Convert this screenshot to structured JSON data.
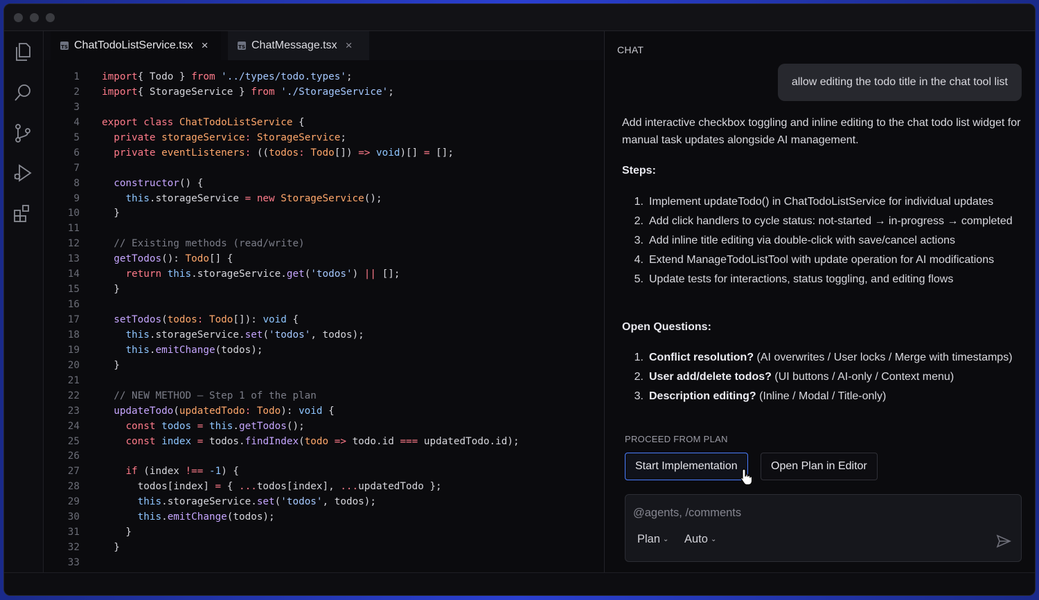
{
  "editor": {
    "tabs": [
      {
        "label": "ChatTodoListService.tsx",
        "icon": "ts-file-icon",
        "active": true
      },
      {
        "label": "ChatMessage.tsx",
        "icon": "ts-file-icon",
        "active": false
      }
    ],
    "ts_badge": "TS",
    "close_glyph": "×",
    "line_numbers": [
      "1",
      "2",
      "3",
      "4",
      "5",
      "6",
      "7",
      "8",
      "9",
      "10",
      "11",
      "12",
      "13",
      "14",
      "15",
      "16",
      "17",
      "18",
      "19",
      "20",
      "21",
      "22",
      "23",
      "24",
      "25",
      "26",
      "27",
      "28",
      "29",
      "30",
      "31",
      "32",
      "33"
    ],
    "code_lines": [
      [
        [
          "kw",
          "import"
        ],
        [
          "",
          "{ Todo } "
        ],
        [
          "kw",
          "from"
        ],
        [
          "",
          " "
        ],
        [
          "str",
          "'../types/todo.types'"
        ],
        [
          "",
          ";"
        ]
      ],
      [
        [
          "kw",
          "import"
        ],
        [
          "",
          "{ StorageService } "
        ],
        [
          "kw",
          "from"
        ],
        [
          "",
          " "
        ],
        [
          "str",
          "'./StorageService'"
        ],
        [
          "",
          ";"
        ]
      ],
      [],
      [
        [
          "kw",
          "export class"
        ],
        [
          "",
          " "
        ],
        [
          "ty",
          "ChatTodoListService"
        ],
        [
          "",
          " {"
        ]
      ],
      [
        [
          "",
          "  "
        ],
        [
          "kw",
          "private"
        ],
        [
          "",
          " "
        ],
        [
          "pa",
          "storageService"
        ],
        [
          "kw",
          ":"
        ],
        [
          "",
          " "
        ],
        [
          "ty",
          "StorageService"
        ],
        [
          "",
          ";"
        ]
      ],
      [
        [
          "",
          "  "
        ],
        [
          "kw",
          "private"
        ],
        [
          "",
          " "
        ],
        [
          "pa",
          "eventListeners"
        ],
        [
          "kw",
          ":"
        ],
        [
          "",
          " (("
        ],
        [
          "pa",
          "todos"
        ],
        [
          "kw",
          ":"
        ],
        [
          "",
          " "
        ],
        [
          "ty",
          "Todo"
        ],
        [
          "",
          "[]) "
        ],
        [
          "kw",
          "=>"
        ],
        [
          "",
          " "
        ],
        [
          "bl",
          "void"
        ],
        [
          "",
          ")[] "
        ],
        [
          "kw",
          "="
        ],
        [
          "",
          " [];"
        ]
      ],
      [],
      [
        [
          "",
          "  "
        ],
        [
          "fn",
          "constructor"
        ],
        [
          "",
          "() {"
        ]
      ],
      [
        [
          "",
          "    "
        ],
        [
          "bl",
          "this"
        ],
        [
          "",
          ".storageService "
        ],
        [
          "kw",
          "="
        ],
        [
          "",
          " "
        ],
        [
          "kw",
          "new"
        ],
        [
          "",
          " "
        ],
        [
          "ty",
          "StorageService"
        ],
        [
          "",
          "();"
        ]
      ],
      [
        [
          "",
          "  }"
        ]
      ],
      [],
      [
        [
          "",
          "  "
        ],
        [
          "cm",
          "// Existing methods (read/write)"
        ]
      ],
      [
        [
          "",
          "  "
        ],
        [
          "fn",
          "getTodos"
        ],
        [
          "",
          "(): "
        ],
        [
          "ty",
          "Todo"
        ],
        [
          "",
          "[] {"
        ]
      ],
      [
        [
          "",
          "    "
        ],
        [
          "kw",
          "return"
        ],
        [
          "",
          " "
        ],
        [
          "bl",
          "this"
        ],
        [
          "",
          ".storageService."
        ],
        [
          "fn",
          "get"
        ],
        [
          "",
          "("
        ],
        [
          "str",
          "'todos'"
        ],
        [
          "",
          ") "
        ],
        [
          "kw",
          "||"
        ],
        [
          "",
          " [];"
        ]
      ],
      [
        [
          "",
          "  }"
        ]
      ],
      [],
      [
        [
          "",
          "  "
        ],
        [
          "fn",
          "setTodos"
        ],
        [
          "",
          "("
        ],
        [
          "pa",
          "todos"
        ],
        [
          "kw",
          ":"
        ],
        [
          "",
          " "
        ],
        [
          "ty",
          "Todo"
        ],
        [
          "",
          "[]): "
        ],
        [
          "bl",
          "void"
        ],
        [
          "",
          " {"
        ]
      ],
      [
        [
          "",
          "    "
        ],
        [
          "bl",
          "this"
        ],
        [
          "",
          ".storageService."
        ],
        [
          "fn",
          "set"
        ],
        [
          "",
          "("
        ],
        [
          "str",
          "'todos'"
        ],
        [
          "",
          ", todos);"
        ]
      ],
      [
        [
          "",
          "    "
        ],
        [
          "bl",
          "this"
        ],
        [
          "",
          "."
        ],
        [
          "fn",
          "emitChange"
        ],
        [
          "",
          "(todos);"
        ]
      ],
      [
        [
          "",
          "  }"
        ]
      ],
      [],
      [
        [
          "",
          "  "
        ],
        [
          "cm",
          "// NEW METHOD — Step 1 of the plan"
        ]
      ],
      [
        [
          "",
          "  "
        ],
        [
          "fn",
          "updateTodo"
        ],
        [
          "",
          "("
        ],
        [
          "pa",
          "updatedTodo"
        ],
        [
          "kw",
          ":"
        ],
        [
          "",
          " "
        ],
        [
          "ty",
          "Todo"
        ],
        [
          "",
          "): "
        ],
        [
          "bl",
          "void"
        ],
        [
          "",
          " {"
        ]
      ],
      [
        [
          "",
          "    "
        ],
        [
          "kw",
          "const"
        ],
        [
          "",
          " "
        ],
        [
          "bl",
          "todos"
        ],
        [
          "",
          " "
        ],
        [
          "kw",
          "="
        ],
        [
          "",
          " "
        ],
        [
          "bl",
          "this"
        ],
        [
          "",
          "."
        ],
        [
          "fn",
          "getTodos"
        ],
        [
          "",
          "();"
        ]
      ],
      [
        [
          "",
          "    "
        ],
        [
          "kw",
          "const"
        ],
        [
          "",
          " "
        ],
        [
          "bl",
          "index"
        ],
        [
          "",
          " "
        ],
        [
          "kw",
          "="
        ],
        [
          "",
          " todos."
        ],
        [
          "fn",
          "findIndex"
        ],
        [
          "",
          "("
        ],
        [
          "pa",
          "todo"
        ],
        [
          "",
          " "
        ],
        [
          "kw",
          "=>"
        ],
        [
          "",
          " todo.id "
        ],
        [
          "kw",
          "==="
        ],
        [
          "",
          " updatedTodo.id);"
        ]
      ],
      [],
      [
        [
          "",
          "    "
        ],
        [
          "kw",
          "if"
        ],
        [
          "",
          " (index "
        ],
        [
          "kw",
          "!=="
        ],
        [
          "",
          " "
        ],
        [
          "bl",
          "-1"
        ],
        [
          "",
          ") {"
        ]
      ],
      [
        [
          "",
          "      todos[index] "
        ],
        [
          "kw",
          "="
        ],
        [
          "",
          " { "
        ],
        [
          "kw",
          "..."
        ],
        [
          "",
          "todos[index], "
        ],
        [
          "kw",
          "..."
        ],
        [
          "",
          "updatedTodo };"
        ]
      ],
      [
        [
          "",
          "      "
        ],
        [
          "bl",
          "this"
        ],
        [
          "",
          ".storageService."
        ],
        [
          "fn",
          "set"
        ],
        [
          "",
          "("
        ],
        [
          "str",
          "'todos'"
        ],
        [
          "",
          ", todos);"
        ]
      ],
      [
        [
          "",
          "      "
        ],
        [
          "bl",
          "this"
        ],
        [
          "",
          "."
        ],
        [
          "fn",
          "emitChange"
        ],
        [
          "",
          "(todos);"
        ]
      ],
      [
        [
          "",
          "    }"
        ]
      ],
      [
        [
          "",
          "  }"
        ]
      ],
      []
    ]
  },
  "chat": {
    "header": "CHAT",
    "user_message": "allow editing the todo title in the chat tool list",
    "intro": "Add interactive checkbox toggling and inline editing to the chat todo list widget for manual task updates alongside AI management.",
    "steps_heading": "Steps:",
    "steps": [
      "Implement updateTodo() in ChatTodoListService for individual updates",
      "Add click handlers to cycle status: not-started → in-progress → completed",
      "Add inline title editing via double-click with save/cancel actions",
      "Extend ManageTodoListTool with update operation for AI modifications",
      "Update tests for interactions, status toggling, and editing flows"
    ],
    "questions_heading": "Open Questions:",
    "questions": [
      {
        "bold": "Conflict resolution?",
        "rest": " (AI overwrites / User locks / Merge with timestamps)"
      },
      {
        "bold": "User add/delete todos?",
        "rest": " (UI buttons / AI-only / Context menu)"
      },
      {
        "bold": "Description editing?",
        "rest": " (Inline / Modal / Title-only)"
      }
    ],
    "proceed_label": "PROCEED FROM PLAN",
    "start_button": "Start Implementation",
    "open_plan_button": "Open Plan in Editor",
    "composer_placeholder": "@agents, /comments",
    "mode": "Plan",
    "model": "Auto"
  },
  "activity_icons": [
    "files-icon",
    "search-icon",
    "source-control-icon",
    "run-debug-icon",
    "extensions-icon"
  ],
  "colors": {
    "accent": "#4a7dff",
    "background": "#0b0b0e"
  }
}
